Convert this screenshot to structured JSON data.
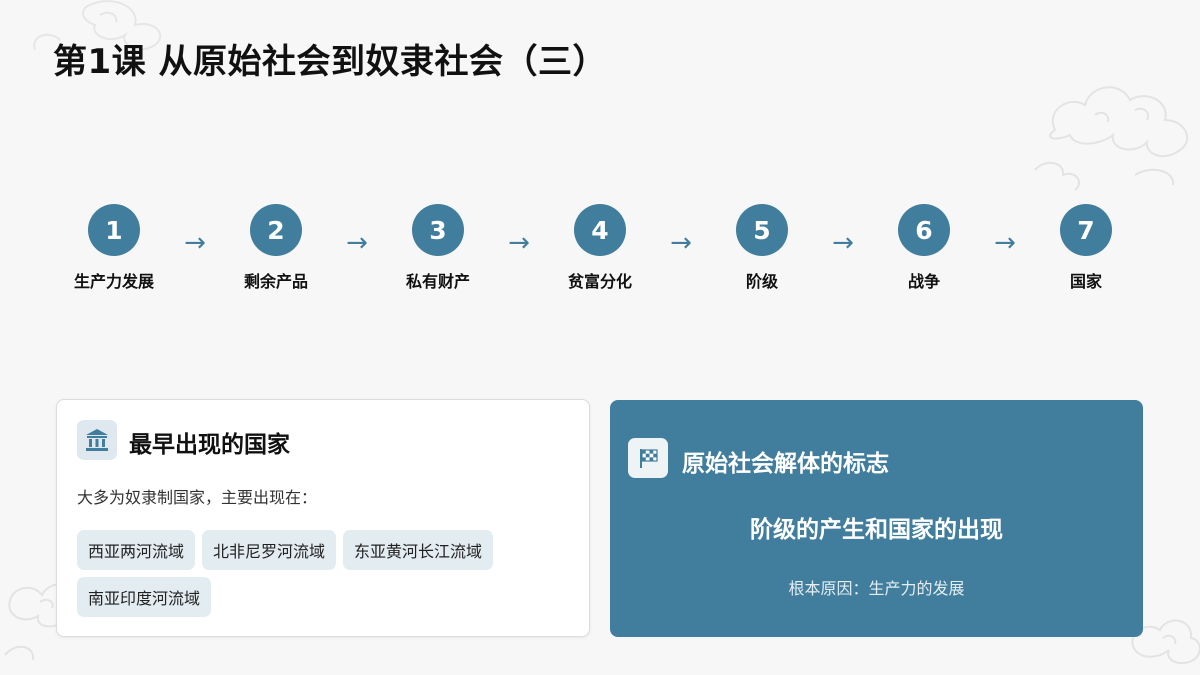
{
  "title": "第1课 从原始社会到奴隶社会（三）",
  "flow": {
    "steps": [
      {
        "num": "1",
        "label": "生产力发展"
      },
      {
        "num": "2",
        "label": "剩余产品"
      },
      {
        "num": "3",
        "label": "私有财产"
      },
      {
        "num": "4",
        "label": "贫富分化"
      },
      {
        "num": "5",
        "label": "阶级"
      },
      {
        "num": "6",
        "label": "战争"
      },
      {
        "num": "7",
        "label": "国家"
      }
    ],
    "arrow": "→"
  },
  "earliest_states": {
    "icon": "landmark-icon",
    "title": "最早出现的国家",
    "description": "大多为奴隶制国家，主要出现在：",
    "regions": [
      "西亚两河流域",
      "北非尼罗河流域",
      "东亚黄河长江流域",
      "南亚印度河流域"
    ]
  },
  "disintegration": {
    "icon": "checkered-flag-icon",
    "title": "原始社会解体的标志",
    "headline": "阶级的产生和国家的出现",
    "cause": "根本原因：生产力的发展"
  },
  "colors": {
    "accent": "#417d9c",
    "chip_bg": "#e3ecf1",
    "background": "#f7f7f7"
  }
}
